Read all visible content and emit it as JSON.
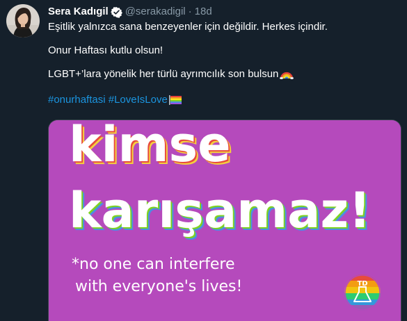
{
  "user": {
    "display_name": "Sera Kadıgil",
    "handle": "@serakadigil",
    "separator": "·",
    "time": "18d",
    "verified": true,
    "avatar_icon": "profile-photo"
  },
  "tweet": {
    "line1": "Eşitlik yalnızca sana benzeyenler için değildir. Herkes içindir.",
    "line2": "Onur Haftası kutlu olsun!",
    "line3": "LGBT+’lara yönelik her türlü ayrımcılık son bulsun",
    "line3_emoji": "rainbow",
    "hashtags": [
      "#onurhaftasi",
      "#LoveIsLove"
    ],
    "hashtag_emoji": "rainbow-flag"
  },
  "media": {
    "background_color": "#b54abc",
    "headline_line1": "kimse",
    "headline_line2": "karışamaz!",
    "subtitle_line1": "*no one can interfere",
    "subtitle_line2": "with everyone's lives!",
    "logo_text": "TD",
    "logo_icon": "flask-icon"
  },
  "colors": {
    "background": "#15202b",
    "text": "#ffffff",
    "muted": "#8899a6",
    "link": "#1b95e0",
    "verified": "#ffffff"
  }
}
